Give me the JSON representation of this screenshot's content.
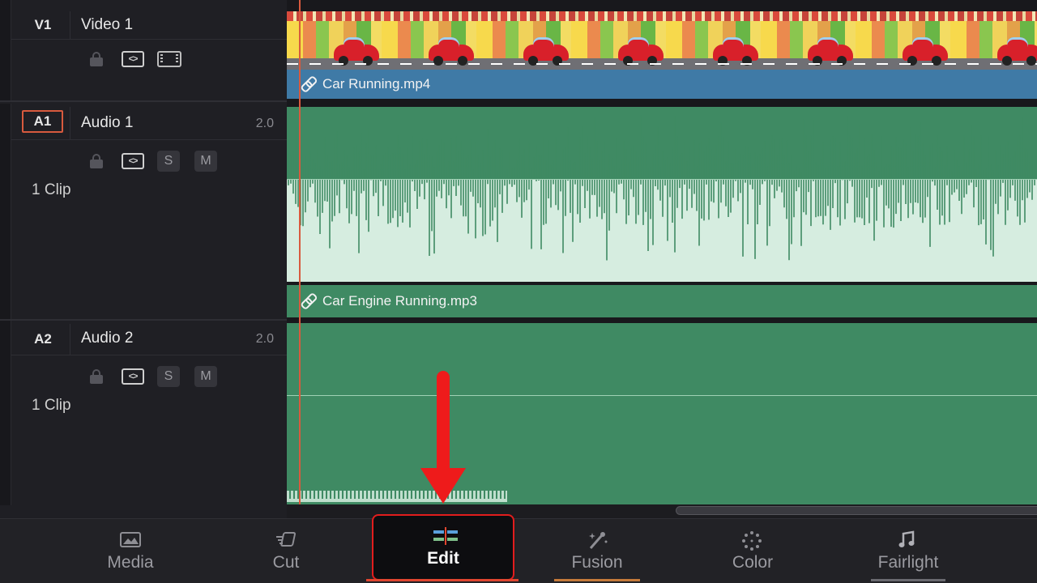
{
  "tracks": {
    "v1": {
      "id": "V1",
      "name": "Video 1",
      "clip_name": "Car Running.mp4"
    },
    "a1": {
      "id": "A1",
      "name": "Audio 1",
      "channels": "2.0",
      "clip_count": "1 Clip",
      "clip_name": "Car Engine Running.mp3",
      "solo": "S",
      "mute": "M"
    },
    "a2": {
      "id": "A2",
      "name": "Audio 2",
      "channels": "2.0",
      "clip_count": "1 Clip",
      "solo": "S",
      "mute": "M"
    }
  },
  "pagebar": {
    "tabs": [
      {
        "label": "Media",
        "icon": "media-icon"
      },
      {
        "label": "Cut",
        "icon": "cut-icon"
      },
      {
        "label": "Edit",
        "icon": "edit-icon",
        "active": true
      },
      {
        "label": "Fusion",
        "icon": "fusion-icon"
      },
      {
        "label": "Color",
        "icon": "color-icon"
      },
      {
        "label": "Fairlight",
        "icon": "fairlight-icon"
      }
    ]
  },
  "colors": {
    "video_clip": "#3f7aa6",
    "audio_clip": "#3f8a63",
    "playhead": "#d85a3e",
    "annotation": "#ee1b1b"
  }
}
